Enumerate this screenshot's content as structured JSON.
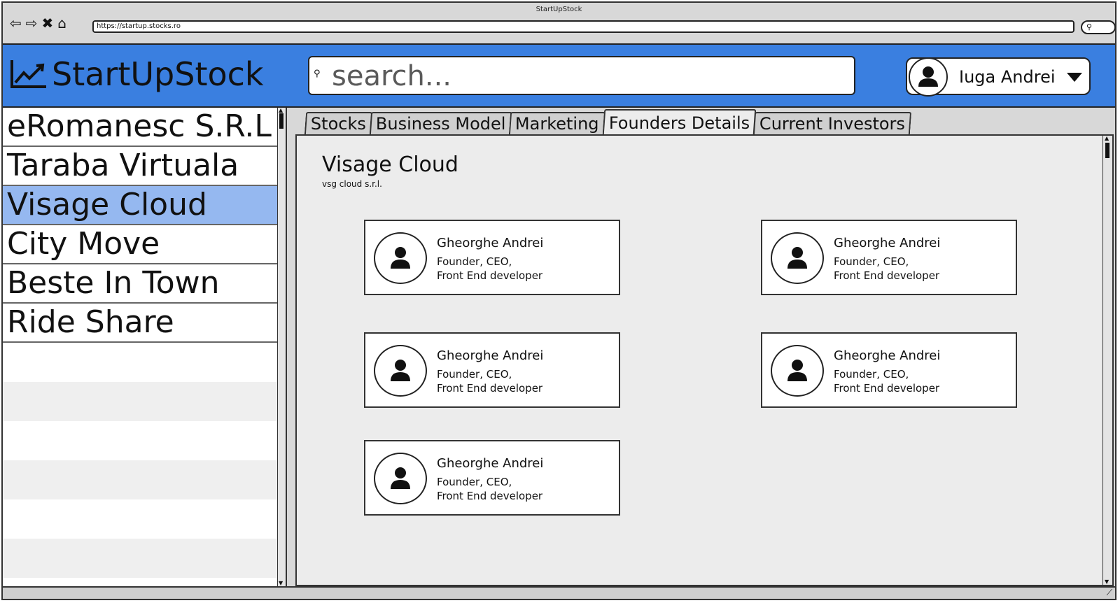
{
  "browser": {
    "title": "StartUpStock",
    "url": "https://startup.stocks.ro"
  },
  "header": {
    "logo_text": "StartUpStock",
    "search_placeholder": "search...",
    "user_name": "Iuga Andrei"
  },
  "sidebar": {
    "items": [
      {
        "label": "eRomanesc S.R.L"
      },
      {
        "label": "Taraba Virtuala"
      },
      {
        "label": "Visage Cloud"
      },
      {
        "label": "City Move"
      },
      {
        "label": "Beste In Town"
      },
      {
        "label": "Ride Share"
      }
    ],
    "selected": "Visage Cloud"
  },
  "tabs": [
    {
      "label": "Stocks"
    },
    {
      "label": "Business Model"
    },
    {
      "label": "Marketing"
    },
    {
      "label": "Founders Details"
    },
    {
      "label": "Current Investors"
    }
  ],
  "active_tab": "Founders Details",
  "company": {
    "name": "Visage Cloud",
    "legal_name": "vsg cloud s.r.l."
  },
  "founders": [
    {
      "name": "Gheorghe Andrei",
      "role_line1": "Founder, CEO,",
      "role_line2": "Front End developer"
    },
    {
      "name": "Gheorghe Andrei",
      "role_line1": "Founder, CEO,",
      "role_line2": "Front End developer"
    },
    {
      "name": "Gheorghe Andrei",
      "role_line1": "Founder, CEO,",
      "role_line2": "Front End developer"
    },
    {
      "name": "Gheorghe Andrei",
      "role_line1": "Founder, CEO,",
      "role_line2": "Front End developer"
    },
    {
      "name": "Gheorghe Andrei",
      "role_line1": "Founder, CEO,",
      "role_line2": "Front End developer"
    }
  ],
  "colors": {
    "header_bg": "#3a7fe0",
    "selected_item_bg": "#95b8f0",
    "panel_bg": "#ececec"
  }
}
